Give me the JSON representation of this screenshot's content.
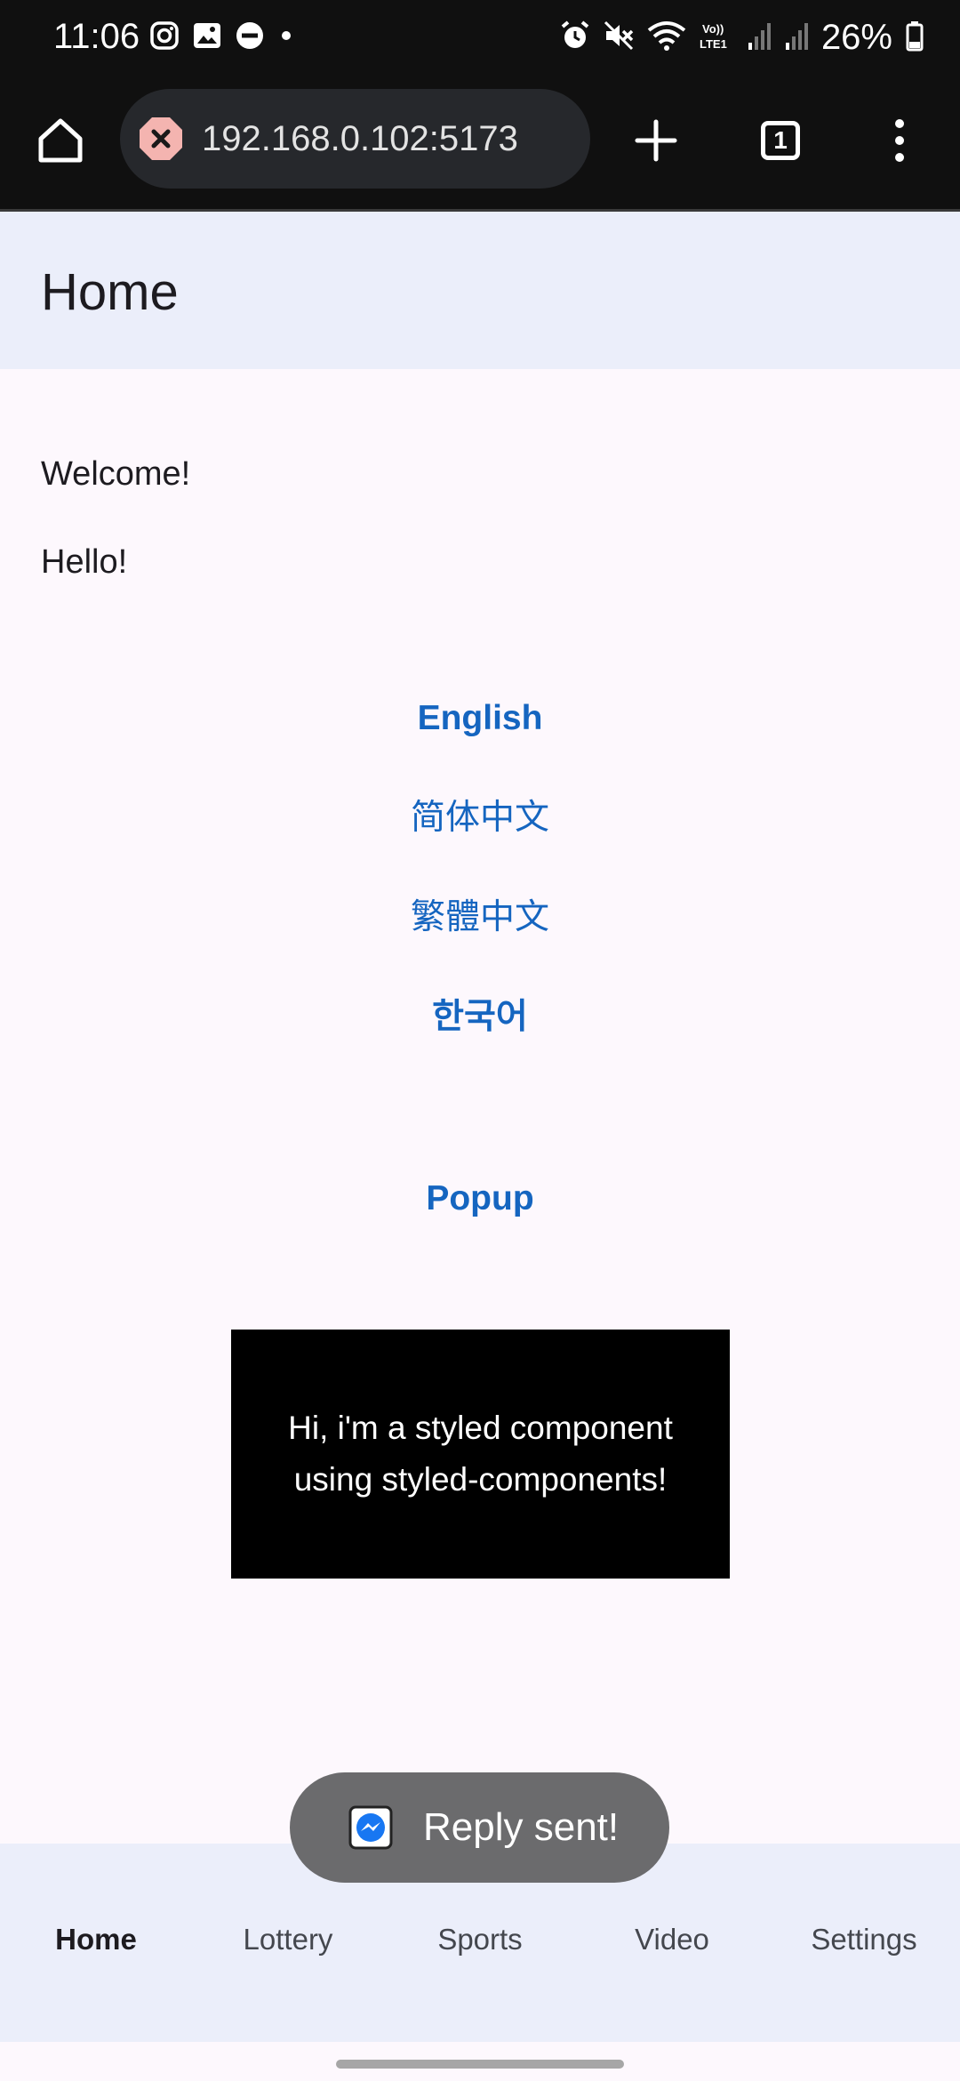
{
  "status_bar": {
    "time": "11:06",
    "battery_percent": "26%",
    "left_icons": [
      "instagram-icon",
      "gallery-icon",
      "do-not-disturb-icon",
      "notification-dot-icon"
    ],
    "right_icons": [
      "alarm-icon",
      "mute-icon",
      "wifi-icon",
      "volte-lte-icon",
      "signal-icon",
      "signal-icon",
      "battery-icon"
    ]
  },
  "browser": {
    "url": "192.168.0.102:5173",
    "tab_count": "1"
  },
  "header": {
    "title": "Home"
  },
  "content": {
    "welcome": "Welcome!",
    "hello": "Hello!",
    "languages": [
      "English",
      "简体中文",
      "繁體中文",
      "한국어"
    ],
    "popup_label": "Popup",
    "styled_box_text": "Hi, i'm a styled component using styled-components!"
  },
  "toast": {
    "text": "Reply sent!"
  },
  "bottom_nav": {
    "items": [
      {
        "label": "Home",
        "active": true
      },
      {
        "label": "Lottery",
        "active": false
      },
      {
        "label": "Sports",
        "active": false
      },
      {
        "label": "Video",
        "active": false
      },
      {
        "label": "Settings",
        "active": false
      }
    ]
  },
  "colors": {
    "link": "#1565c0",
    "header_bg": "#ebeefa",
    "page_bg": "#fdf8fd",
    "toast_bg": "#6b6b6d"
  }
}
